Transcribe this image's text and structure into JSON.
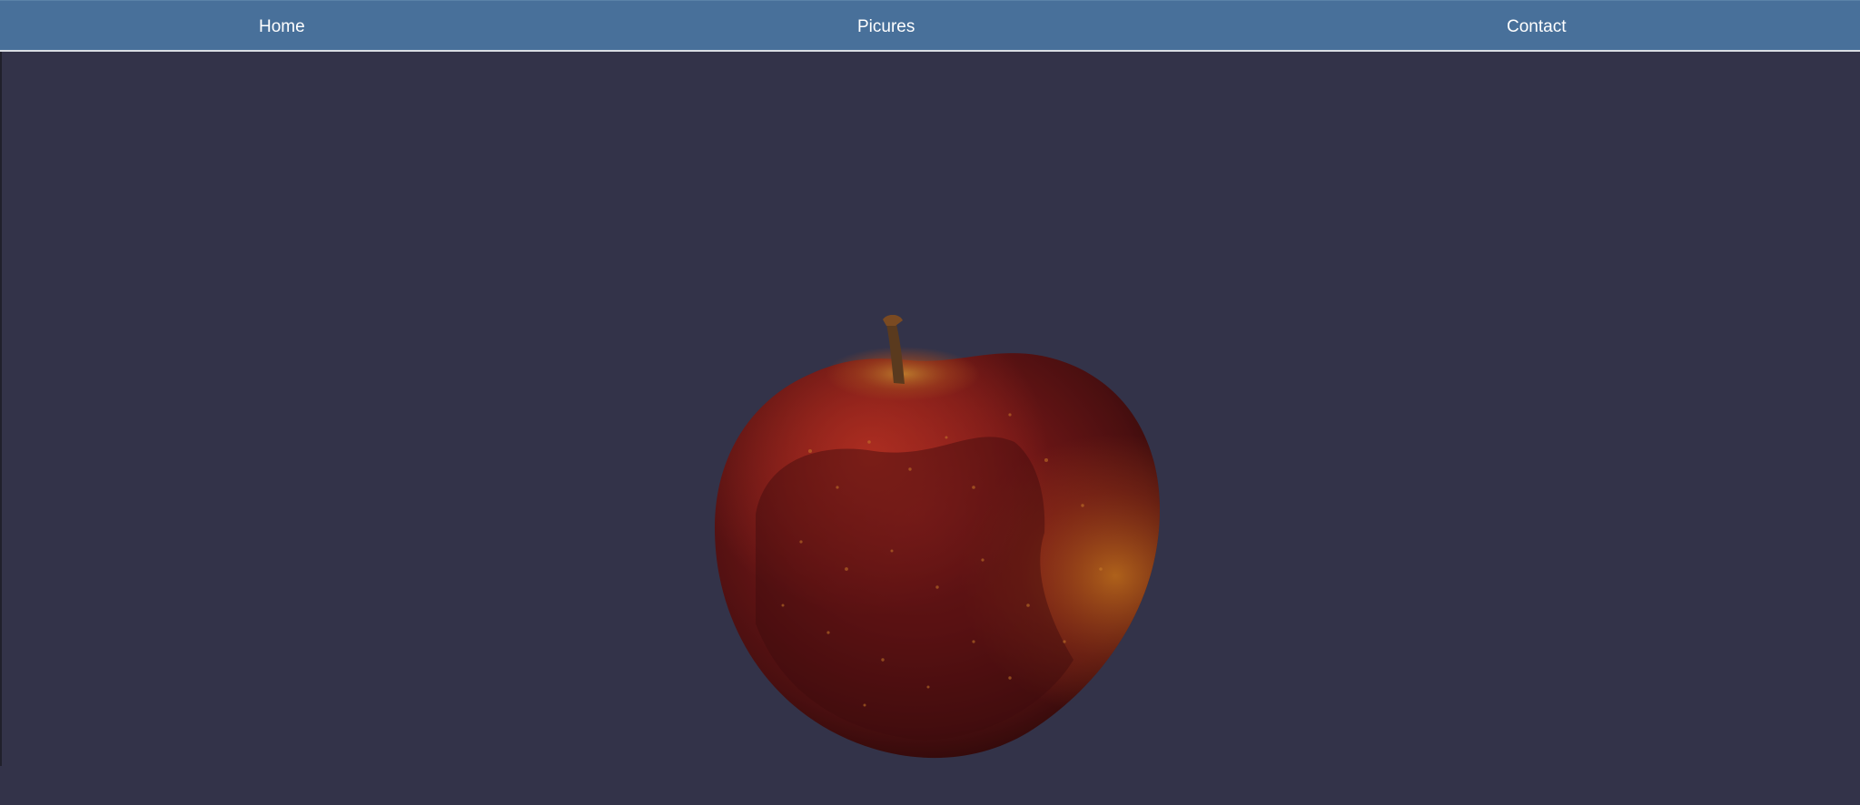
{
  "nav": {
    "items": [
      {
        "label": "Home"
      },
      {
        "label": "Picures"
      },
      {
        "label": "Contact"
      }
    ]
  },
  "main": {
    "image_icon": "apple-photo"
  },
  "colors": {
    "navbar": "#48709a",
    "background": "#333349",
    "nav_text": "#ffffff"
  }
}
